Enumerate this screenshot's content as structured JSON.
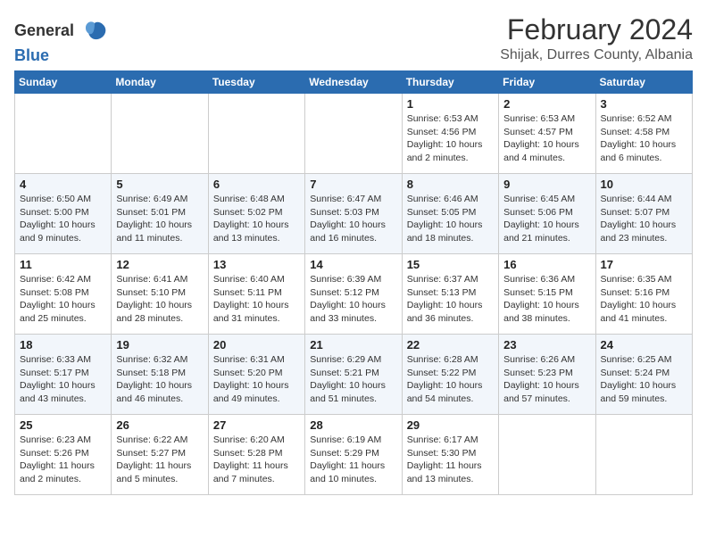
{
  "header": {
    "logo_general": "General",
    "logo_blue": "Blue",
    "title": "February 2024",
    "subtitle": "Shijak, Durres County, Albania"
  },
  "calendar": {
    "days_of_week": [
      "Sunday",
      "Monday",
      "Tuesday",
      "Wednesday",
      "Thursday",
      "Friday",
      "Saturday"
    ],
    "weeks": [
      [
        {
          "day": "",
          "info": ""
        },
        {
          "day": "",
          "info": ""
        },
        {
          "day": "",
          "info": ""
        },
        {
          "day": "",
          "info": ""
        },
        {
          "day": "1",
          "info": "Sunrise: 6:53 AM\nSunset: 4:56 PM\nDaylight: 10 hours\nand 2 minutes."
        },
        {
          "day": "2",
          "info": "Sunrise: 6:53 AM\nSunset: 4:57 PM\nDaylight: 10 hours\nand 4 minutes."
        },
        {
          "day": "3",
          "info": "Sunrise: 6:52 AM\nSunset: 4:58 PM\nDaylight: 10 hours\nand 6 minutes."
        }
      ],
      [
        {
          "day": "4",
          "info": "Sunrise: 6:50 AM\nSunset: 5:00 PM\nDaylight: 10 hours\nand 9 minutes."
        },
        {
          "day": "5",
          "info": "Sunrise: 6:49 AM\nSunset: 5:01 PM\nDaylight: 10 hours\nand 11 minutes."
        },
        {
          "day": "6",
          "info": "Sunrise: 6:48 AM\nSunset: 5:02 PM\nDaylight: 10 hours\nand 13 minutes."
        },
        {
          "day": "7",
          "info": "Sunrise: 6:47 AM\nSunset: 5:03 PM\nDaylight: 10 hours\nand 16 minutes."
        },
        {
          "day": "8",
          "info": "Sunrise: 6:46 AM\nSunset: 5:05 PM\nDaylight: 10 hours\nand 18 minutes."
        },
        {
          "day": "9",
          "info": "Sunrise: 6:45 AM\nSunset: 5:06 PM\nDaylight: 10 hours\nand 21 minutes."
        },
        {
          "day": "10",
          "info": "Sunrise: 6:44 AM\nSunset: 5:07 PM\nDaylight: 10 hours\nand 23 minutes."
        }
      ],
      [
        {
          "day": "11",
          "info": "Sunrise: 6:42 AM\nSunset: 5:08 PM\nDaylight: 10 hours\nand 25 minutes."
        },
        {
          "day": "12",
          "info": "Sunrise: 6:41 AM\nSunset: 5:10 PM\nDaylight: 10 hours\nand 28 minutes."
        },
        {
          "day": "13",
          "info": "Sunrise: 6:40 AM\nSunset: 5:11 PM\nDaylight: 10 hours\nand 31 minutes."
        },
        {
          "day": "14",
          "info": "Sunrise: 6:39 AM\nSunset: 5:12 PM\nDaylight: 10 hours\nand 33 minutes."
        },
        {
          "day": "15",
          "info": "Sunrise: 6:37 AM\nSunset: 5:13 PM\nDaylight: 10 hours\nand 36 minutes."
        },
        {
          "day": "16",
          "info": "Sunrise: 6:36 AM\nSunset: 5:15 PM\nDaylight: 10 hours\nand 38 minutes."
        },
        {
          "day": "17",
          "info": "Sunrise: 6:35 AM\nSunset: 5:16 PM\nDaylight: 10 hours\nand 41 minutes."
        }
      ],
      [
        {
          "day": "18",
          "info": "Sunrise: 6:33 AM\nSunset: 5:17 PM\nDaylight: 10 hours\nand 43 minutes."
        },
        {
          "day": "19",
          "info": "Sunrise: 6:32 AM\nSunset: 5:18 PM\nDaylight: 10 hours\nand 46 minutes."
        },
        {
          "day": "20",
          "info": "Sunrise: 6:31 AM\nSunset: 5:20 PM\nDaylight: 10 hours\nand 49 minutes."
        },
        {
          "day": "21",
          "info": "Sunrise: 6:29 AM\nSunset: 5:21 PM\nDaylight: 10 hours\nand 51 minutes."
        },
        {
          "day": "22",
          "info": "Sunrise: 6:28 AM\nSunset: 5:22 PM\nDaylight: 10 hours\nand 54 minutes."
        },
        {
          "day": "23",
          "info": "Sunrise: 6:26 AM\nSunset: 5:23 PM\nDaylight: 10 hours\nand 57 minutes."
        },
        {
          "day": "24",
          "info": "Sunrise: 6:25 AM\nSunset: 5:24 PM\nDaylight: 10 hours\nand 59 minutes."
        }
      ],
      [
        {
          "day": "25",
          "info": "Sunrise: 6:23 AM\nSunset: 5:26 PM\nDaylight: 11 hours\nand 2 minutes."
        },
        {
          "day": "26",
          "info": "Sunrise: 6:22 AM\nSunset: 5:27 PM\nDaylight: 11 hours\nand 5 minutes."
        },
        {
          "day": "27",
          "info": "Sunrise: 6:20 AM\nSunset: 5:28 PM\nDaylight: 11 hours\nand 7 minutes."
        },
        {
          "day": "28",
          "info": "Sunrise: 6:19 AM\nSunset: 5:29 PM\nDaylight: 11 hours\nand 10 minutes."
        },
        {
          "day": "29",
          "info": "Sunrise: 6:17 AM\nSunset: 5:30 PM\nDaylight: 11 hours\nand 13 minutes."
        },
        {
          "day": "",
          "info": ""
        },
        {
          "day": "",
          "info": ""
        }
      ]
    ]
  }
}
